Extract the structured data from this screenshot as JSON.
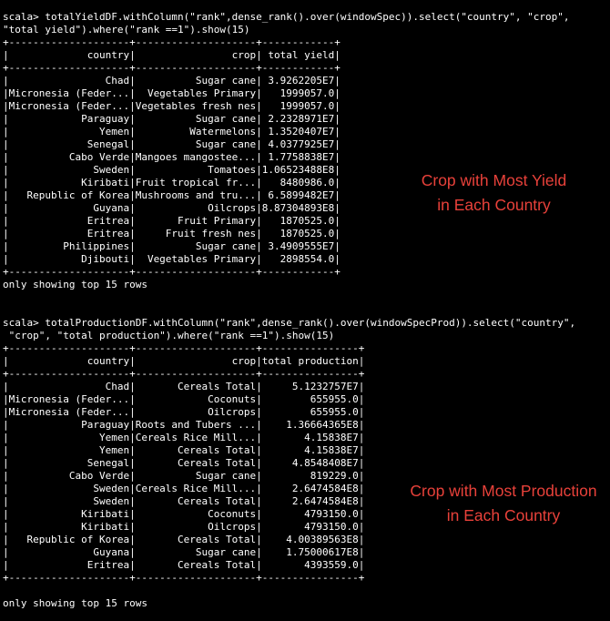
{
  "query1": {
    "command_lines": [
      "scala> totalYieldDF.withColumn(\"rank\",dense_rank().over(windowSpec)).select(\"country\", \"crop\",",
      "\"total yield\").where(\"rank ==1\").show(15)"
    ],
    "columns": [
      "country",
      "crop",
      "total yield"
    ],
    "rows": [
      [
        "Chad",
        "Sugar cane",
        "3.9262205E7"
      ],
      [
        "Micronesia (Feder...",
        "Vegetables Primary",
        "1999057.0"
      ],
      [
        "Micronesia (Feder...",
        "Vegetables fresh nes",
        "1999057.0"
      ],
      [
        "Paraguay",
        "Sugar cane",
        "2.2328971E7"
      ],
      [
        "Yemen",
        "Watermelons",
        "1.3520407E7"
      ],
      [
        "Senegal",
        "Sugar cane",
        "4.0377925E7"
      ],
      [
        "Cabo Verde",
        "Mangoes mangostee...",
        "1.7758838E7"
      ],
      [
        "Sweden",
        "Tomatoes",
        "1.06523488E8"
      ],
      [
        "Kiribati",
        "Fruit tropical fr...",
        "8480986.0"
      ],
      [
        "Republic of Korea",
        "Mushrooms and tru...",
        "6.5899482E7"
      ],
      [
        "Guyana",
        "Oilcrops",
        "8.87304893E8"
      ],
      [
        "Eritrea",
        "Fruit Primary",
        "1870525.0"
      ],
      [
        "Eritrea",
        "Fruit fresh nes",
        "1870525.0"
      ],
      [
        "Philippines",
        "Sugar cane",
        "3.4909555E7"
      ],
      [
        "Djibouti",
        "Vegetables Primary",
        "2898554.0"
      ]
    ],
    "footer": "only showing top 15 rows",
    "annotation": [
      "Crop with Most Yield",
      "in Each Country"
    ]
  },
  "query2": {
    "command_lines": [
      "scala> totalProductionDF.withColumn(\"rank\",dense_rank().over(windowSpecProd)).select(\"country\",",
      " \"crop\", \"total production\").where(\"rank ==1\").show(15)"
    ],
    "columns": [
      "country",
      "crop",
      "total production"
    ],
    "rows": [
      [
        "Chad",
        "Cereals Total",
        "5.1232757E7"
      ],
      [
        "Micronesia (Feder...",
        "Coconuts",
        "655955.0"
      ],
      [
        "Micronesia (Feder...",
        "Oilcrops",
        "655955.0"
      ],
      [
        "Paraguay",
        "Roots and Tubers ...",
        "1.36664365E8"
      ],
      [
        "Yemen",
        "Cereals Rice Mill...",
        "4.15838E7"
      ],
      [
        "Yemen",
        "Cereals Total",
        "4.15838E7"
      ],
      [
        "Senegal",
        "Cereals Total",
        "4.8548408E7"
      ],
      [
        "Cabo Verde",
        "Sugar cane",
        "819229.0"
      ],
      [
        "Sweden",
        "Cereals Rice Mill...",
        "2.6474584E8"
      ],
      [
        "Sweden",
        "Cereals Total",
        "2.6474584E8"
      ],
      [
        "Kiribati",
        "Coconuts",
        "4793150.0"
      ],
      [
        "Kiribati",
        "Oilcrops",
        "4793150.0"
      ],
      [
        "Republic of Korea",
        "Cereals Total",
        "4.00389563E8"
      ],
      [
        "Guyana",
        "Sugar cane",
        "1.75000617E8"
      ],
      [
        "Eritrea",
        "Cereals Total",
        "4393559.0"
      ]
    ],
    "footer": "only showing top 15 rows",
    "annotation": [
      "Crop with Most Production",
      "in Each Country"
    ]
  },
  "colors": {
    "background": "#000000",
    "text": "#ffffff",
    "annotation": "#e8413a"
  }
}
